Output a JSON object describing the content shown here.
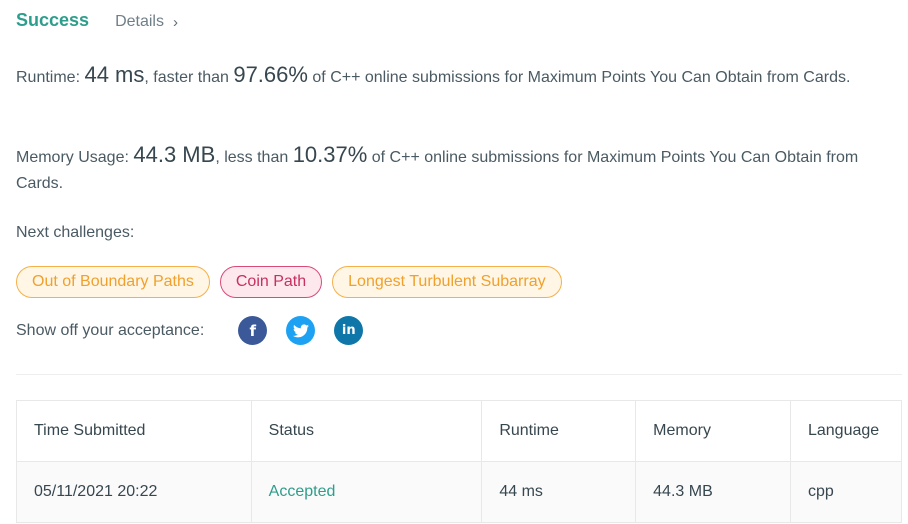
{
  "header": {
    "title": "Success",
    "details_label": "Details",
    "details_chevron": "›"
  },
  "runtime": {
    "label": "Runtime: ",
    "value": "44 ms",
    "mid": ", faster than ",
    "percent": "97.66%",
    "suffix": " of C++ online submissions for Maximum Points You Can Obtain from Cards."
  },
  "memory": {
    "label": "Memory Usage: ",
    "value": "44.3 MB",
    "mid": ", less than ",
    "percent": "10.37%",
    "suffix": " of C++ online submissions for Maximum Points You Can Obtain from Cards."
  },
  "next_challenges": {
    "label": "Next challenges:",
    "items": [
      "Out of Boundary Paths",
      "Coin Path",
      "Longest Turbulent Subarray"
    ]
  },
  "share": {
    "label": "Show off your acceptance:",
    "icons": [
      {
        "name": "facebook-icon",
        "glyph": "f"
      },
      {
        "name": "twitter-icon",
        "glyph": "t"
      },
      {
        "name": "linkedin-icon",
        "glyph": "in"
      }
    ]
  },
  "table": {
    "headers": [
      "Time Submitted",
      "Status",
      "Runtime",
      "Memory",
      "Language"
    ],
    "rows": [
      [
        "05/11/2021 20:22",
        "Accepted",
        "44 ms",
        "44.3 MB",
        "cpp"
      ]
    ]
  },
  "colors": {
    "success": "#2e9e8c",
    "chip_orange": "#f0a02c",
    "chip_pink": "#c7305f",
    "facebook": "#3b5998",
    "twitter": "#1da1f2",
    "linkedin": "#0e76a8"
  }
}
